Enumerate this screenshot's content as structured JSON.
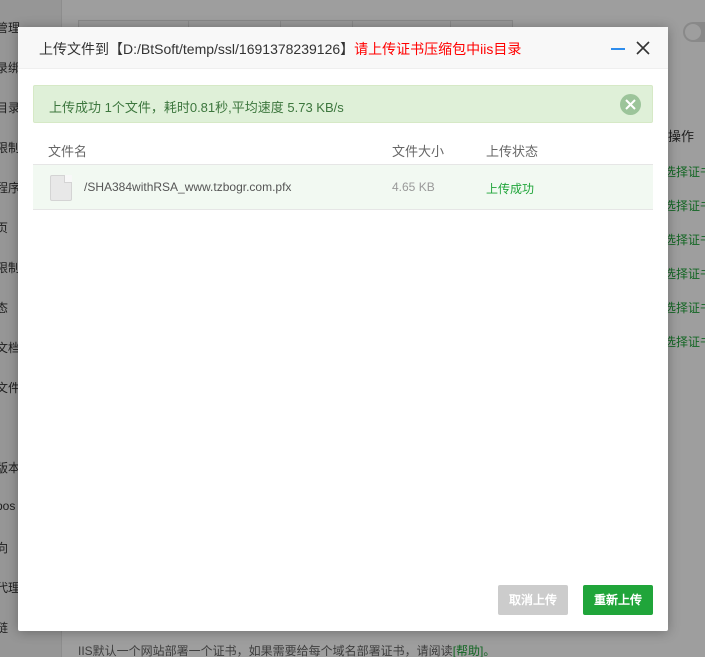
{
  "background": {
    "sidebar_items": [
      "管理",
      "录绑",
      "目录",
      "限制",
      "程序",
      "页",
      "限制",
      "态",
      "文档",
      "文件",
      "版本",
      "pos",
      "向",
      "代理",
      "链"
    ],
    "ops_header": "操作",
    "ops_links": [
      "选择证书",
      "选择证书",
      "选择证书",
      "选择证书",
      "选择证书",
      "选择证书"
    ],
    "note": {
      "text": "IIS默认一个网站部署一个证书，如果需要给每个域名部署证书，请阅读",
      "help": "[帮助]。"
    }
  },
  "dialog": {
    "title_prefix": "上传文件到【D:/BtSoft/temp/ssl/1691378239126】",
    "title_warning": "请上传证书压缩包中iis目录",
    "alert_text": "上传成功 1个文件，耗时0.81秒,平均速度 5.73 KB/s",
    "columns": {
      "name": "文件名",
      "size": "文件大小",
      "status": "上传状态"
    },
    "files": [
      {
        "name": "/SHA384withRSA_www.tzbogr.com.pfx",
        "size": "4.65 KB",
        "status": "上传成功",
        "icon": "file-icon"
      }
    ],
    "buttons": {
      "cancel": "取消上传",
      "reupload": "重新上传"
    }
  },
  "colors": {
    "accent": "#20a53a",
    "warning": "#ff0000",
    "alert_bg": "#dff0d8",
    "alert_text": "#3c763d"
  }
}
